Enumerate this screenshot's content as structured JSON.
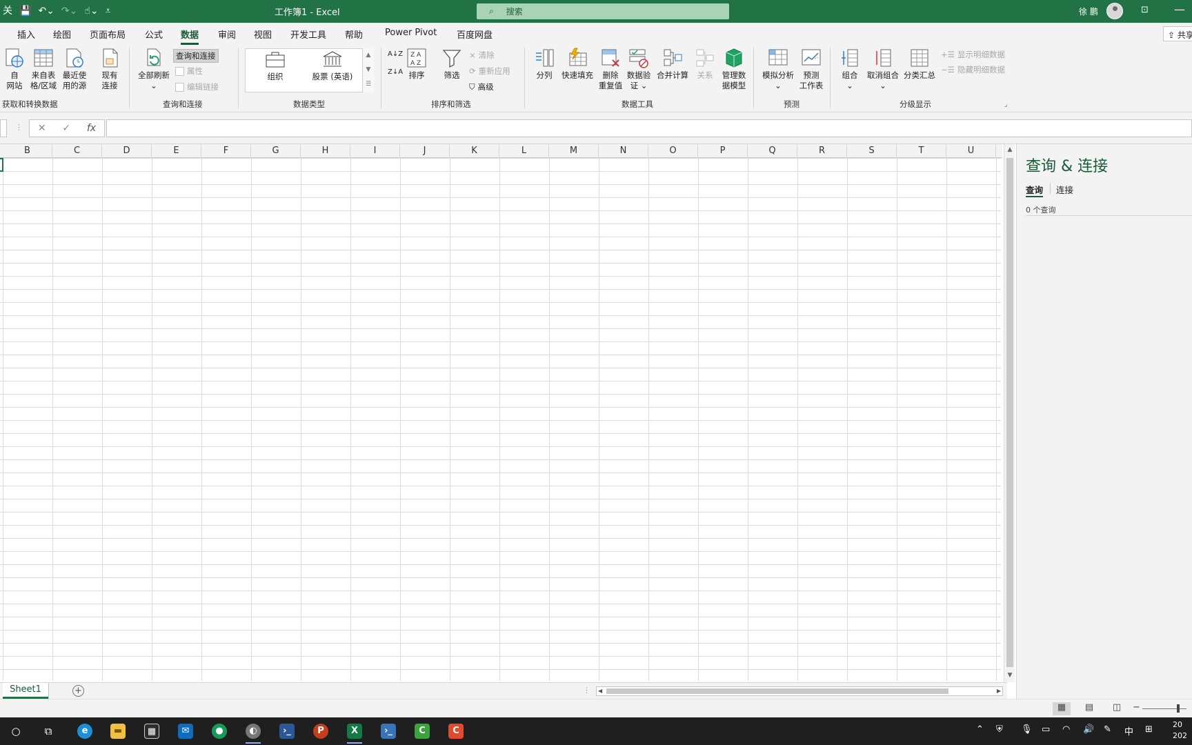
{
  "window": {
    "title": "工作簿1 - Excel",
    "search_placeholder": "搜索",
    "user_name": "徐 鹏",
    "qat": {
      "autosave": "关",
      "save": "💾",
      "undo": "↶⌄",
      "redo": "↷⌄",
      "touch": "☝⌄",
      "customize": "⩡"
    },
    "ribbon_display": "⊡",
    "minimize": "—"
  },
  "ribbon_tabs": [
    {
      "label": "插入"
    },
    {
      "label": "绘图"
    },
    {
      "label": "页面布局"
    },
    {
      "label": "公式"
    },
    {
      "label": "数据",
      "active": true
    },
    {
      "label": "审阅"
    },
    {
      "label": "视图"
    },
    {
      "label": "开发工具"
    },
    {
      "label": "帮助"
    },
    {
      "label": "Power Pivot"
    },
    {
      "label": "百度网盘"
    }
  ],
  "share_label": "⇪ 共享",
  "ribbon": {
    "get_transform": {
      "label": "获取和转换数据",
      "from_web_line1": "自",
      "from_web_line2": "网站",
      "from_table_line1": "来自表",
      "from_table_line2": "格/区域",
      "recent_line1": "最近使",
      "recent_line2": "用的源",
      "existing_line1": "现有",
      "existing_line2": "连接"
    },
    "queries_connections": {
      "label": "查询和连接",
      "refresh_all": "全部刷新",
      "queries_connections_btn": "查询和连接",
      "properties": "属性",
      "edit_links": "编辑链接"
    },
    "data_types": {
      "label": "数据类型",
      "org": "组织",
      "stocks": "股票 (英语)"
    },
    "sort_filter": {
      "label": "排序和筛选",
      "sort_az": "A↓Z",
      "sort_za": "Z↓A",
      "sort": "排序",
      "filter": "筛选",
      "clear": "清除",
      "reapply": "重新应用",
      "advanced": "高级"
    },
    "data_tools": {
      "label": "数据工具",
      "text_to_columns": "分列",
      "flash_fill": "快速填充",
      "remove_dup_line1": "删除",
      "remove_dup_line2": "重复值",
      "validation_line1": "数据验",
      "validation_line2": "证 ⌄",
      "consolidate": "合并计算",
      "relationships": "关系",
      "data_model_line1": "管理数",
      "data_model_line2": "据模型"
    },
    "forecast": {
      "label": "预测",
      "what_if_line1": "模拟分析",
      "what_if_line2": "⌄",
      "sheet_line1": "预测",
      "sheet_line2": "工作表"
    },
    "outline": {
      "label": "分级显示",
      "group_line1": "组合",
      "group_line2": "⌄",
      "ungroup_line1": "取消组合",
      "ungroup_line2": "⌄",
      "subtotal": "分类汇总",
      "show_detail": "显示明细数据",
      "hide_detail": "隐藏明细数据"
    }
  },
  "formula_bar": {
    "cancel": "✕",
    "enter": "✓",
    "fx": "fx",
    "value": ""
  },
  "columns": [
    "B",
    "C",
    "D",
    "E",
    "F",
    "G",
    "H",
    "I",
    "J",
    "K",
    "L",
    "M",
    "N",
    "O",
    "P",
    "Q",
    "R",
    "S",
    "T",
    "U"
  ],
  "sheet_tabs": [
    {
      "label": "Sheet1",
      "active": true
    }
  ],
  "add_sheet": "+",
  "side_pane": {
    "title": "查询 & 连接",
    "tabs": [
      {
        "label": "查询",
        "active": true
      },
      {
        "label": "连接"
      }
    ],
    "count_text": "0 个查询"
  },
  "taskbar": {
    "ime": "中",
    "clock_line1": "20",
    "clock_line2": "202"
  }
}
